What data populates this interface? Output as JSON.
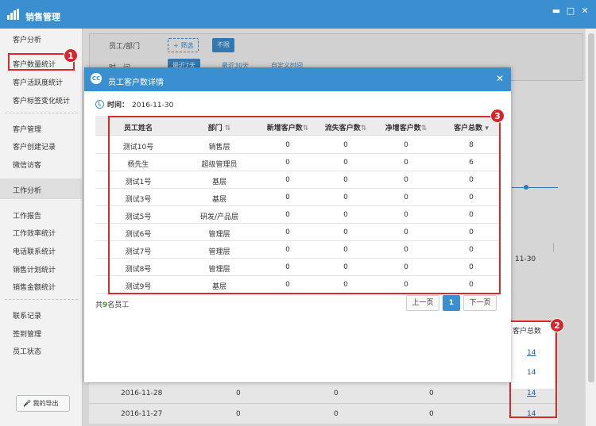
{
  "app": {
    "title": "销售管理"
  },
  "sidebar": {
    "items": [
      {
        "label": "客户分析"
      },
      {
        "label": "客户数量统计"
      },
      {
        "label": "客户活跃度统计"
      },
      {
        "label": "客户标签变化统计"
      },
      {
        "label": "客户管理"
      },
      {
        "label": "客户创建记录"
      },
      {
        "label": "微信访客"
      },
      {
        "label": "工作分析"
      },
      {
        "label": "工作报告"
      },
      {
        "label": "工作效率统计"
      },
      {
        "label": "电话联系统计"
      },
      {
        "label": "销售计划统计"
      },
      {
        "label": "销售金额统计"
      },
      {
        "label": "联系记录"
      },
      {
        "label": "签到管理"
      },
      {
        "label": "员工状态"
      }
    ],
    "export_label": "我的导出"
  },
  "filters": {
    "dept_label": "员工/部门",
    "filter_button": "+ 筛选",
    "unlimited": "不限",
    "time_label": "时　间",
    "tabs": [
      "最近7天",
      "最近30天",
      "自定义时间"
    ]
  },
  "background": {
    "chart_tick": "11-30",
    "column_header": "客户总数",
    "rows": [
      {
        "date": "",
        "c1": "",
        "c2": "",
        "c3": "",
        "total": "14"
      },
      {
        "date": "",
        "c1": "",
        "c2": "",
        "c3": "",
        "total": "14"
      },
      {
        "date": "2016-11-28",
        "c1": "0",
        "c2": "0",
        "c3": "0",
        "total": "14"
      },
      {
        "date": "2016-11-27",
        "c1": "0",
        "c2": "0",
        "c3": "0",
        "total": "14"
      }
    ]
  },
  "modal": {
    "title": "员工客户数详情",
    "time_label": "时间：",
    "time_value": "2016-11-30",
    "columns": [
      "员工姓名",
      "部门",
      "新增客户数",
      "流失客户数",
      "净增客户数",
      "客户总数"
    ],
    "rows": [
      [
        "测试10号",
        "销售层",
        "0",
        "0",
        "0",
        "8"
      ],
      [
        "杨先生",
        "超级管理员",
        "0",
        "0",
        "0",
        "6"
      ],
      [
        "测试1号",
        "基层",
        "0",
        "0",
        "0",
        "0"
      ],
      [
        "测试3号",
        "基层",
        "0",
        "0",
        "0",
        "0"
      ],
      [
        "测试5号",
        "研发/产品层",
        "0",
        "0",
        "0",
        "0"
      ],
      [
        "测试6号",
        "管理层",
        "0",
        "0",
        "0",
        "0"
      ],
      [
        "测试7号",
        "管理层",
        "0",
        "0",
        "0",
        "0"
      ],
      [
        "测试8号",
        "管理层",
        "0",
        "0",
        "0",
        "0"
      ],
      [
        "测试9号",
        "基层",
        "0",
        "0",
        "0",
        "0"
      ]
    ],
    "total_prefix": "共",
    "total_count": "9",
    "total_suffix": "名员工",
    "pagination": {
      "prev": "上一页",
      "current": "1",
      "next": "下一页"
    }
  },
  "annotations": {
    "badge1": "1",
    "badge2": "2",
    "badge3": "3"
  },
  "colors": {
    "primary": "#3a8fd1",
    "highlight": "#d62b2b",
    "count": "#3a9a2a"
  }
}
